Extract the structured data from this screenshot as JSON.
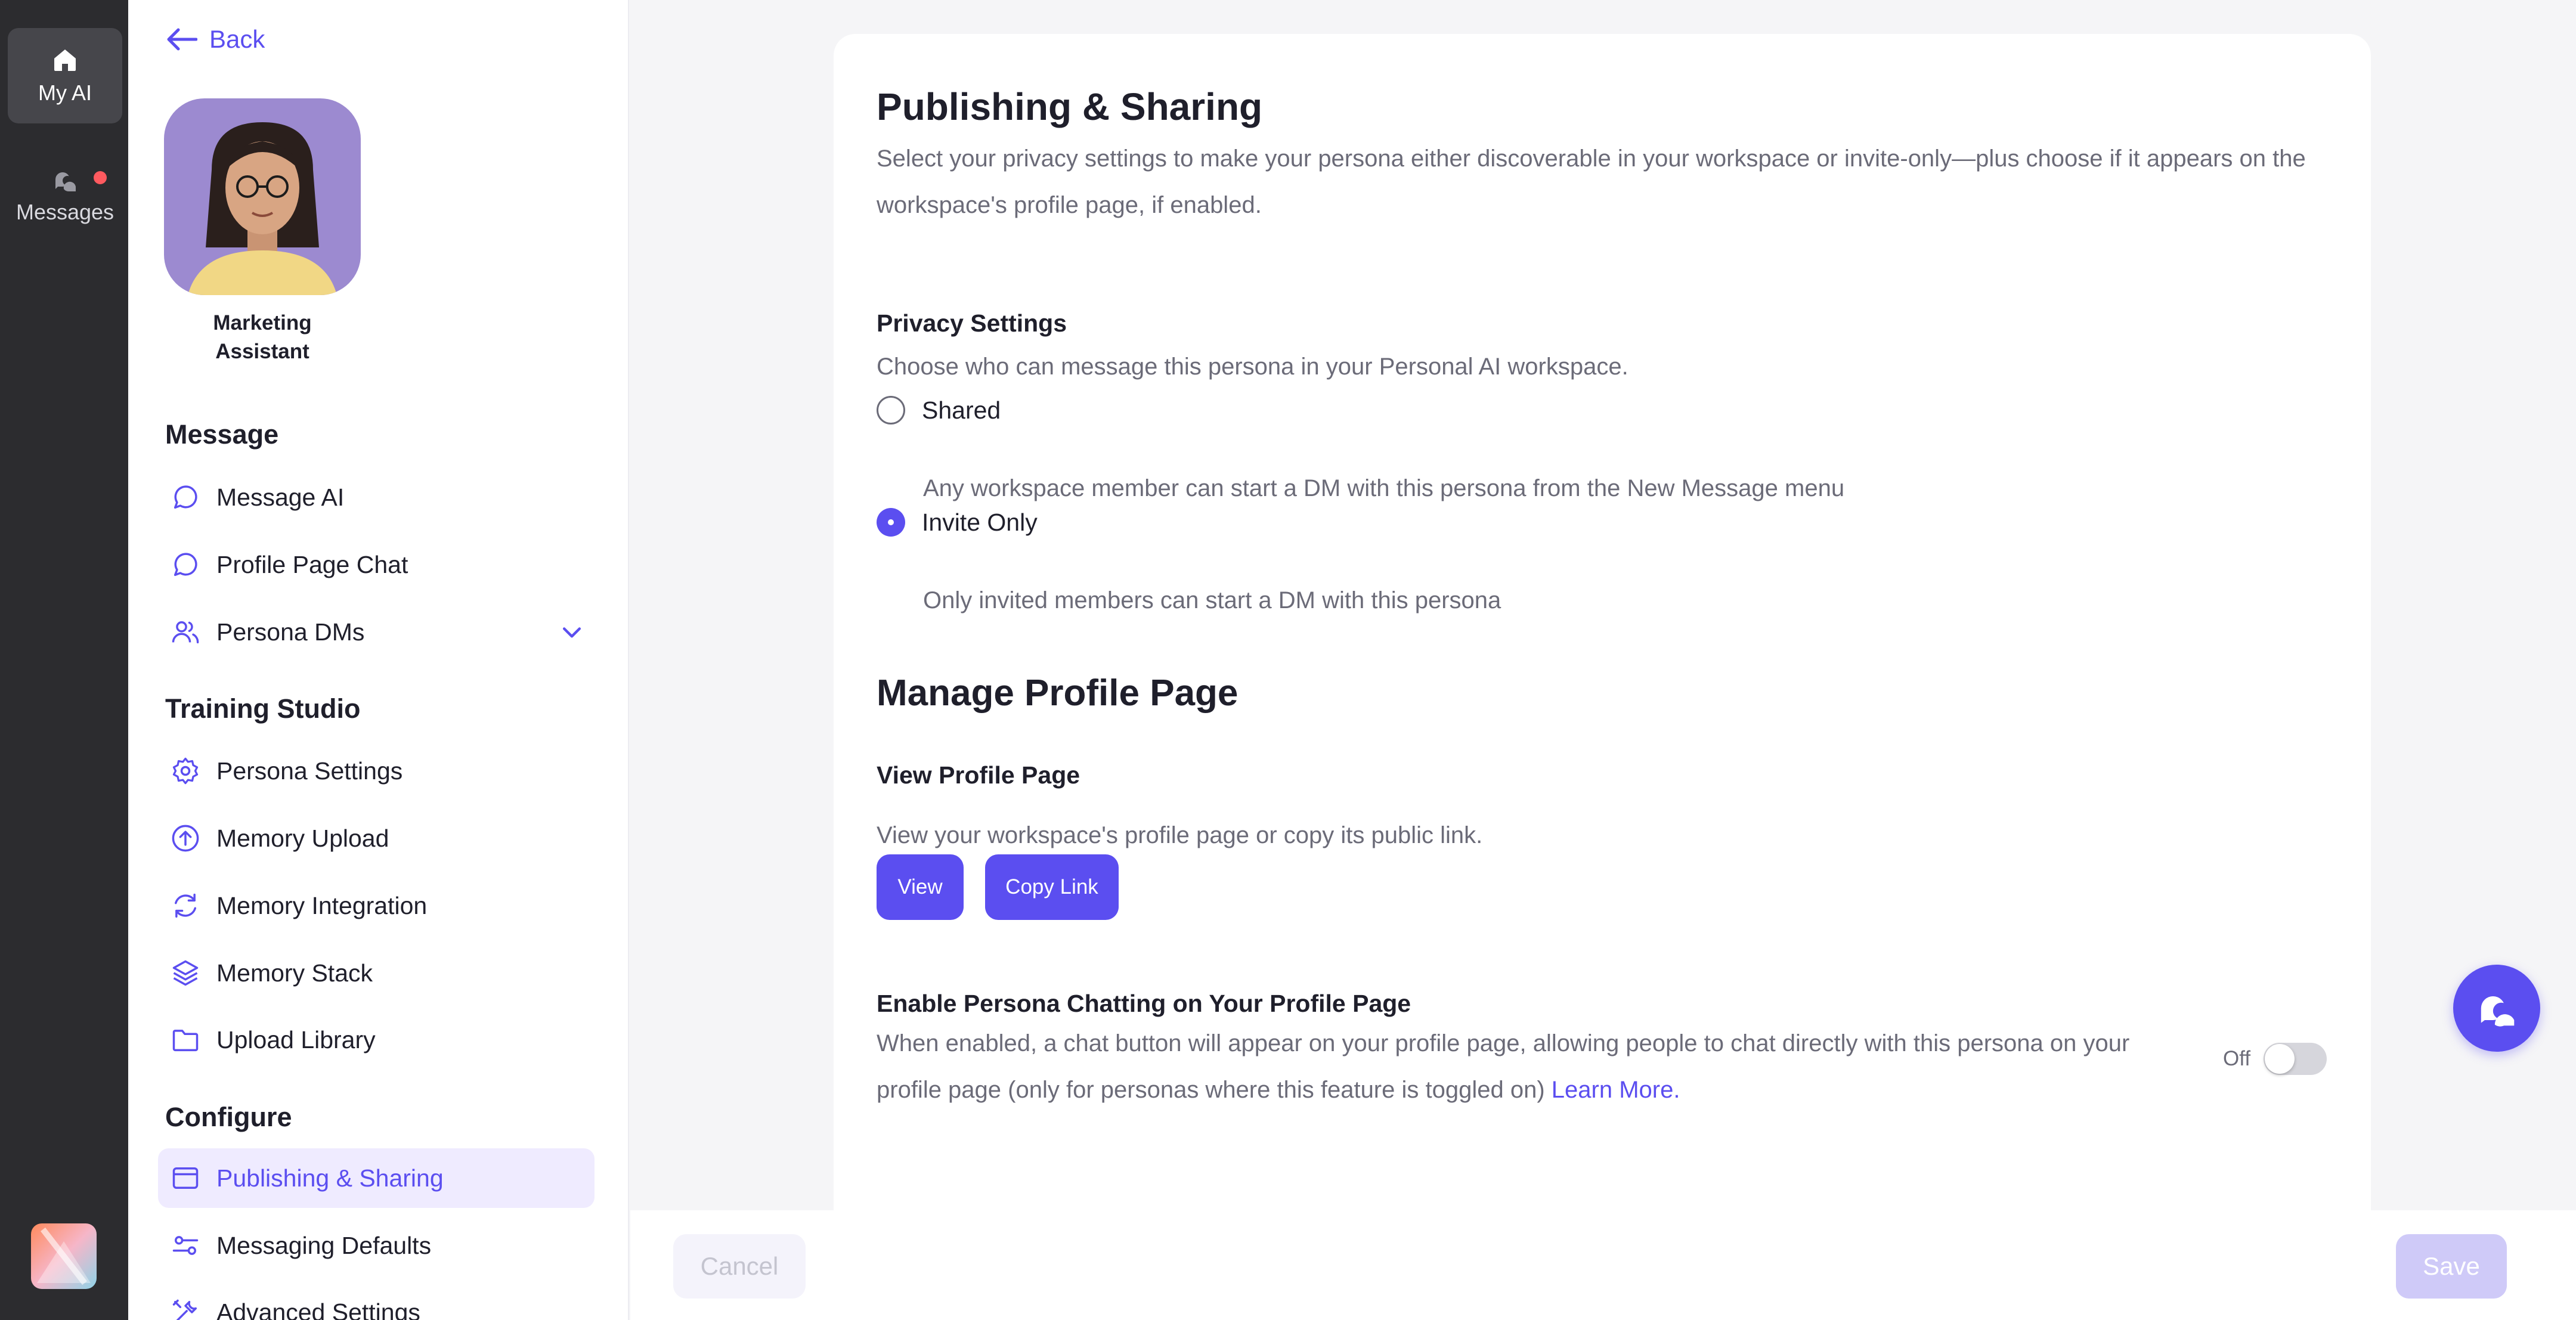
{
  "rail": {
    "items": [
      {
        "label": "My AI",
        "icon": "home-icon",
        "active": true
      },
      {
        "label": "Messages",
        "icon": "chat-bubbles-icon",
        "has_notification": true
      }
    ]
  },
  "sidebar": {
    "back_label": "Back",
    "persona_name": "Marketing Assistant",
    "sections": {
      "message": {
        "title": "Message",
        "items": [
          {
            "label": "Message AI",
            "icon": "chat-bubble-icon"
          },
          {
            "label": "Profile Page Chat",
            "icon": "chat-bubble-icon"
          },
          {
            "label": "Persona DMs",
            "icon": "users-icon",
            "expandable": true
          }
        ]
      },
      "training": {
        "title": "Training Studio",
        "items": [
          {
            "label": "Persona Settings",
            "icon": "gear-icon"
          },
          {
            "label": "Memory Upload",
            "icon": "upload-circle-icon"
          },
          {
            "label": "Memory Integration",
            "icon": "refresh-icon"
          },
          {
            "label": "Memory Stack",
            "icon": "layers-icon"
          },
          {
            "label": "Upload Library",
            "icon": "folder-icon"
          }
        ]
      },
      "configure": {
        "title": "Configure",
        "items": [
          {
            "label": "Publishing & Sharing",
            "icon": "window-icon",
            "active": true
          },
          {
            "label": "Messaging Defaults",
            "icon": "sliders-icon"
          },
          {
            "label": "Advanced Settings",
            "icon": "tools-icon"
          }
        ]
      }
    }
  },
  "main": {
    "title": "Publishing & Sharing",
    "description": "Select your privacy settings to make your persona either discoverable in your workspace or invite-only—plus choose if it appears on the workspace's profile page, if enabled.",
    "privacy": {
      "title": "Privacy Settings",
      "subtitle": "Choose who can message this persona in your Personal AI workspace.",
      "options": [
        {
          "label": "Shared",
          "description": "Any workspace member can start a DM with this persona from the New Message menu",
          "selected": false
        },
        {
          "label": "Invite Only",
          "description": "Only invited members can start a DM with this persona",
          "selected": true
        }
      ]
    },
    "profile": {
      "title": "Manage Profile Page",
      "view_title": "View Profile Page",
      "view_subtitle": "View your workspace's profile page or copy its public link.",
      "view_button": "View",
      "copy_button": "Copy Link",
      "chat_title": "Enable Persona Chatting on Your Profile Page",
      "chat_desc": "When enabled, a chat button will appear on your profile page, allowing people to chat directly with this persona on your profile page (only for personas where this feature is toggled on)",
      "learn_more": "Learn More.",
      "toggle_label": "Off",
      "toggle_on": false
    }
  },
  "footer": {
    "cancel_label": "Cancel",
    "save_label": "Save"
  },
  "colors": {
    "accent": "#5b4ef0",
    "rail_bg": "#2c2c2f",
    "notification": "#ff5a5f",
    "active_nav_bg": "#efebff"
  }
}
